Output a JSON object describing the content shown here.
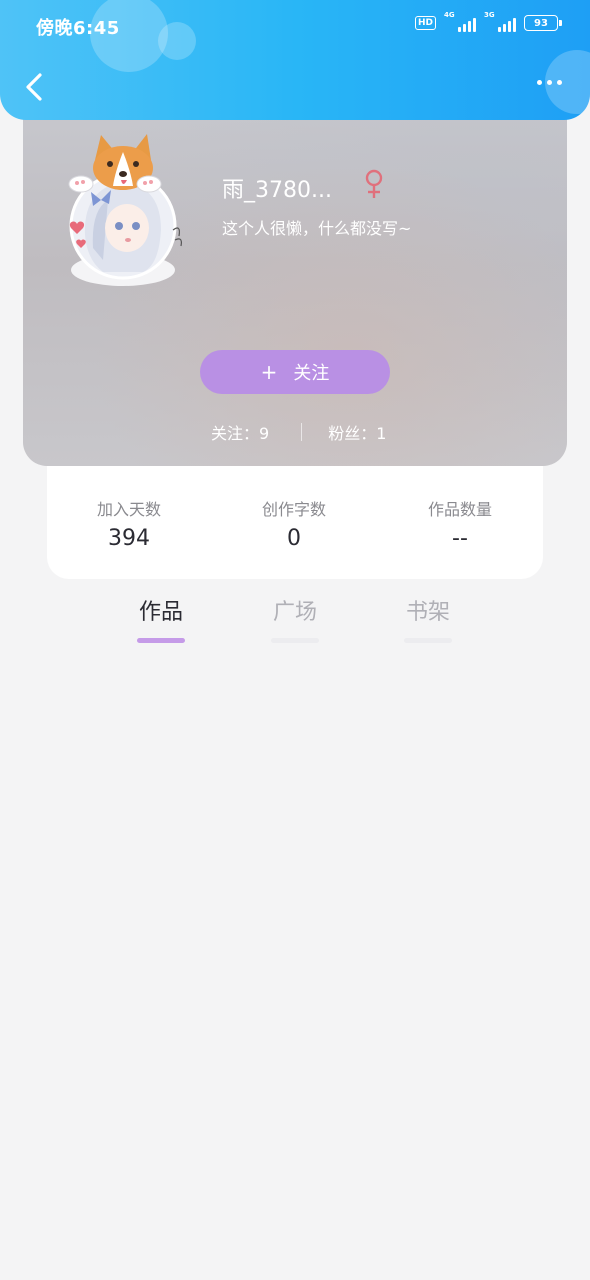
{
  "status_bar": {
    "time": "傍晚6:45",
    "hd_label": "HD",
    "network1": "4G",
    "network2": "3G",
    "battery": "93"
  },
  "icons": {
    "back": "chevron-left-icon",
    "more": "more-dots-icon",
    "gender": "female-icon"
  },
  "colors": {
    "header_blue": "#29b6f6",
    "follow_button": "#b990e4",
    "tab_active_underline": "#c59be8",
    "gender_icon": "#e0707c"
  },
  "profile": {
    "username": "雨_3780...",
    "bio": "这个人很懒，什么都没写~",
    "follow_button": "关注",
    "follow_plus": "+",
    "following": "关注：9",
    "fans": "粉丝：1"
  },
  "stats": [
    {
      "label": "加入天数",
      "value": "394"
    },
    {
      "label": "创作字数",
      "value": "0"
    },
    {
      "label": "作品数量",
      "value": "--"
    }
  ],
  "tabs": [
    {
      "label": "作品",
      "active": true
    },
    {
      "label": "广场",
      "active": false
    },
    {
      "label": "书架",
      "active": false
    }
  ]
}
